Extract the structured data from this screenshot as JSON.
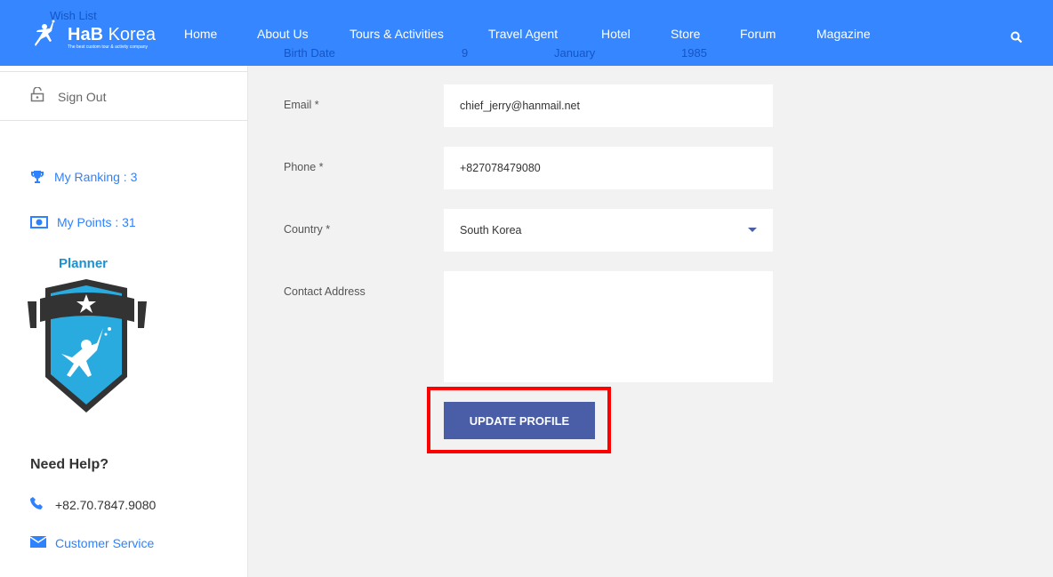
{
  "header": {
    "logo_name_bold": "HaB",
    "logo_name_light": "Korea",
    "logo_tagline": "The best custom tour & activity company",
    "nav": [
      "Home",
      "About Us",
      "Tours & Activities",
      "Travel Agent",
      "Hotel",
      "Store",
      "Forum",
      "Magazine"
    ]
  },
  "background_overlay": {
    "wish_list": "Wish List",
    "birth_date_label": "Birth Date",
    "day": "9",
    "month": "January",
    "year": "1985"
  },
  "sidebar": {
    "sign_out": "Sign Out",
    "ranking": "My Ranking : 3",
    "points": "My Points : 31",
    "badge_title": "Planner",
    "help_title": "Need Help?",
    "phone": "+82.70.7847.9080",
    "customer_service": "Customer Service"
  },
  "form": {
    "email_label": "Email *",
    "email_value": "chief_jerry@hanmail.net",
    "phone_label": "Phone *",
    "phone_value": "+827078479080",
    "country_label": "Country *",
    "country_value": "South Korea",
    "address_label": "Contact Address",
    "address_value": "",
    "submit": "UPDATE PROFILE"
  },
  "colors": {
    "header": "#2e82ff",
    "button": "#4a5ea8",
    "highlight": "#ff0000",
    "badge": "#29abdf"
  }
}
